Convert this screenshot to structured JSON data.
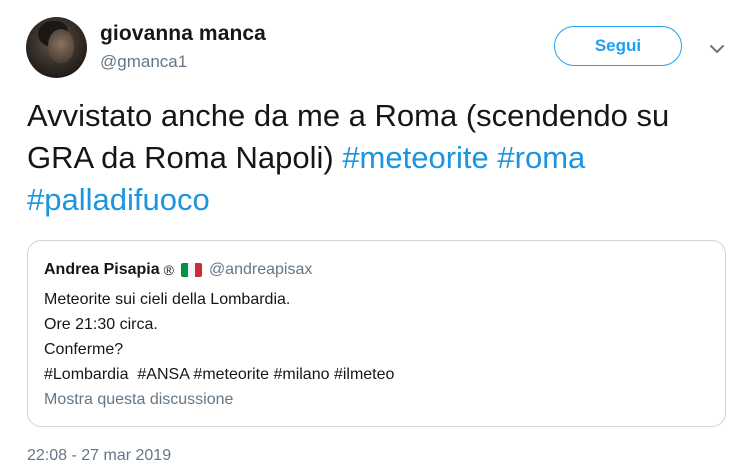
{
  "author": {
    "name": "giovanna manca",
    "handle": "@gmanca1"
  },
  "follow_button_label": "Segui",
  "tweet": {
    "text_parts": [
      "Avvistato anche da me a Roma (scendendo su GRA da Roma Napoli) ",
      "#meteorite",
      " ",
      "#roma",
      " ",
      "#palladifuoco"
    ]
  },
  "quoted_tweet": {
    "name": "Andrea Pisapia",
    "registered_mark": "®",
    "flag": "italy-flag-icon",
    "handle": "@andreapisax",
    "lines": [
      "Meteorite sui cieli della Lombardia.",
      "Ore 21:30 circa.",
      "Conferme?",
      "#Lombardia  #ANSA #meteorite #milano #ilmeteo"
    ],
    "show_thread_label": "Mostra questa discussione"
  },
  "timestamp": "22:08 - 27 mar 2019",
  "colors": {
    "accent": "#1da1f2",
    "hashtag": "#1b95e0",
    "secondary_text": "#657786",
    "border": "#ccd6dd"
  }
}
